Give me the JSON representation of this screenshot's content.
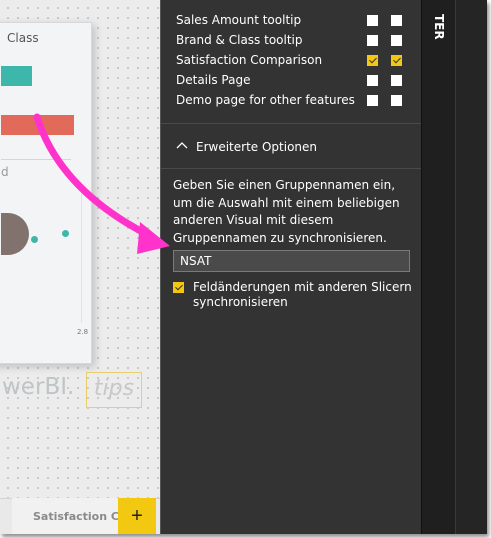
{
  "canvas": {
    "card_title": "Class",
    "card_subtitle": "d",
    "axis_label": "2.8",
    "watermark": "werBI.",
    "watermark_tips": "tips",
    "page_tab": "Satisfaction Co",
    "add_page_icon": "+"
  },
  "pages": [
    {
      "label": "Sales Amount tooltip",
      "col1": false,
      "col2": false
    },
    {
      "label": "Brand & Class tooltip",
      "col1": false,
      "col2": false
    },
    {
      "label": "Satisfaction Comparison",
      "col1": true,
      "col2": true
    },
    {
      "label": "Details Page",
      "col1": false,
      "col2": false
    },
    {
      "label": "Demo page for other features",
      "col1": false,
      "col2": false
    }
  ],
  "advanced": {
    "title": "Erweiterte Optionen",
    "description": "Geben Sie einen Gruppennamen ein, um die Auswahl mit einem beliebigen anderen Visual mit diesem Gruppennamen zu synchronisieren.",
    "group_name": "NSAT",
    "sync_checkbox_checked": true,
    "sync_label": "Feldänderungen mit anderen Slicern synchronisieren"
  },
  "right_strip": {
    "label": "TER"
  },
  "colors": {
    "accent": "#f2c811",
    "pane": "#333333",
    "arrow": "#ff33cc"
  }
}
